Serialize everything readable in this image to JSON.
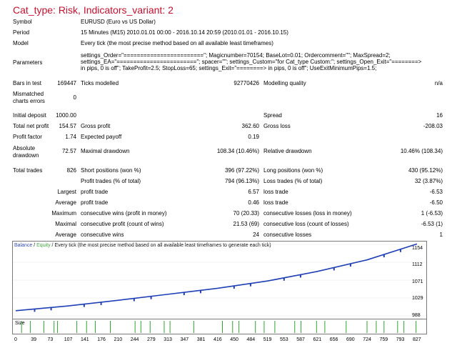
{
  "title": "Cat_type: Risk, Indicators_variant: 2",
  "rows": {
    "symbol": {
      "label": "Symbol",
      "value": "EURUSD (Euro vs US Dollar)"
    },
    "period": {
      "label": "Period",
      "value": "15 Minutes (M15) 2010.01.01 00:00 - 2016.10.14 20:59 (2010.01.01 - 2016.10.15)"
    },
    "model": {
      "label": "Model",
      "value": "Every tick (the most precise method based on all available least timeframes)"
    },
    "parameters": {
      "label": "Parameters",
      "line1": "settings_Order=\"========================\"; Magicnumber=70154; BaseLot=0.01; Ordercomment=\"\"; MaxSpread=2;",
      "line2": "settings_EA=\"========================\"; spacer=\"\"; settings_Custom=\"for Cat_type Custom:\"; settings_Open_Exit=\"========>",
      "line3": "in pips, 0 is off\"; TakeProfit=2.5; StopLoss=65; settings_Exit=\"========> in pips, 0 is off\"; UseExitMinimumPips=1.5;"
    }
  },
  "stats": {
    "bars": {
      "label": "Bars in test",
      "value": "169447",
      "label2": "Ticks modelled",
      "value2": "92770426",
      "label3": "Modelling quality",
      "value3": "n/a"
    },
    "mismatched": {
      "label1": "Mismatched",
      "label2": "charts errors",
      "value": "0"
    },
    "deposit": {
      "label": "Initial deposit",
      "value": "1000.00",
      "label3": "Spread",
      "value3": "16"
    },
    "net": {
      "label": "Total net profit",
      "value": "154.57",
      "label2": "Gross profit",
      "value2": "362.60",
      "label3": "Gross loss",
      "value3": "-208.03"
    },
    "pf": {
      "label": "Profit factor",
      "value": "1.74",
      "label2": "Expected payoff",
      "value2": "0.19"
    },
    "dd": {
      "label1": "Absolute",
      "label2": "drawdown",
      "value": "72.57",
      "label2b": "Maximal drawdown",
      "value2": "108.34 (10.46%)",
      "label3": "Relative drawdown",
      "value3": "10.46% (108.34)"
    },
    "trades": {
      "label": "Total trades",
      "value": "826",
      "label2": "Short positions (won %)",
      "value2": "396 (97.22%)",
      "label3": "Long positions (won %)",
      "value3": "430 (95.12%)"
    },
    "ptrades": {
      "label2": "Profit trades (% of total)",
      "value2": "794 (96.13%)",
      "label3": "Loss trades (% of total)",
      "value3": "32 (3.87%)"
    },
    "largest": {
      "prefix": "Largest",
      "label2": "profit trade",
      "value2": "6.57",
      "label3": "loss trade",
      "value3": "-6.53"
    },
    "average": {
      "prefix": "Average",
      "label2": "profit trade",
      "value2": "0.46",
      "label3": "loss trade",
      "value3": "-6.50"
    },
    "maximum": {
      "prefix": "Maximum",
      "label2": "consecutive wins (profit in money)",
      "value2": "70 (20.33)",
      "label3": "consecutive losses (loss in money)",
      "value3": "1 (-6.53)"
    },
    "maximal": {
      "prefix": "Maximal",
      "label2": "consecutive profit (count of wins)",
      "value2": "21.53 (69)",
      "label3": "consecutive loss (count of losses)",
      "value3": "-6.53 (1)"
    },
    "average2": {
      "prefix": "Average",
      "label2": "consecutive wins",
      "value2": "24",
      "label3": "consecutive losses",
      "value3": "1"
    }
  },
  "chart_legend": {
    "balance": "Balance",
    "sep": " / ",
    "equity": "Equity",
    "rest": " / Every tick (the most precise method based on all available least timeframes to generate each tick)"
  },
  "colors": {
    "balance": "#1f3fb5",
    "equity": "#2fa52f",
    "title": "#c8102e"
  },
  "chart_data": {
    "type": "line",
    "series": [
      {
        "name": "Balance"
      },
      {
        "name": "Equity"
      }
    ],
    "y_ticks": [
      "1154",
      "1112",
      "1071",
      "1029",
      "988"
    ],
    "ylim": [
      988,
      1154
    ],
    "x_ticks": [
      "0",
      "39",
      "73",
      "107",
      "141",
      "176",
      "210",
      "244",
      "279",
      "313",
      "347",
      "381",
      "416",
      "450",
      "484",
      "519",
      "553",
      "587",
      "621",
      "656",
      "690",
      "724",
      "759",
      "793",
      "827"
    ],
    "xlim": [
      0,
      827
    ],
    "size_label": "Size",
    "balance_points": [
      [
        0,
        1000
      ],
      [
        107,
        1011
      ],
      [
        210,
        1024
      ],
      [
        313,
        1038
      ],
      [
        416,
        1052
      ],
      [
        519,
        1069
      ],
      [
        621,
        1091
      ],
      [
        724,
        1118
      ],
      [
        827,
        1155
      ]
    ],
    "equity_dips": [
      [
        39,
        1002
      ],
      [
        73,
        1006
      ],
      [
        141,
        1015
      ],
      [
        176,
        1018
      ],
      [
        244,
        1026
      ],
      [
        279,
        1030
      ],
      [
        347,
        1041
      ],
      [
        381,
        1046
      ],
      [
        450,
        1056
      ],
      [
        484,
        1062
      ],
      [
        553,
        1074
      ],
      [
        587,
        1080
      ],
      [
        656,
        1096
      ],
      [
        690,
        1105
      ],
      [
        759,
        1125
      ],
      [
        793,
        1140
      ]
    ],
    "size_markers": [
      12,
      30,
      58,
      79,
      86,
      126,
      146,
      164,
      195,
      246,
      258,
      277,
      306,
      318,
      367,
      426,
      447,
      460,
      494,
      512,
      534,
      575,
      588,
      620,
      637,
      681,
      724,
      743,
      759,
      787,
      800,
      825
    ]
  }
}
